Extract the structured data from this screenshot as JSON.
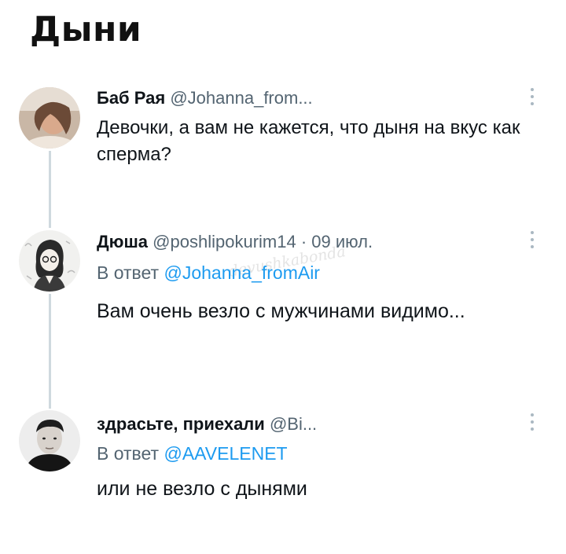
{
  "page_title": "Дыни",
  "watermark": "devushkabonda",
  "tweets": [
    {
      "author": "Баб Рая",
      "handle": "@Johanna_from...",
      "date": "",
      "reply_label": "",
      "reply_to": "",
      "text": "Девочки, а вам не кажется, что дыня на вкус как сперма?",
      "avatar_icon": "avatar-photo-woman",
      "more_icon": "more-vertical-icon"
    },
    {
      "author": "Дюша",
      "handle": "@poshlipokurim14",
      "date": "· 09 июл.",
      "reply_label": "В ответ",
      "reply_to": "@Johanna_fromAir",
      "text": "Вам очень везло с мужчинами видимо...",
      "avatar_icon": "avatar-drawing",
      "more_icon": "more-vertical-icon"
    },
    {
      "author": "здрасьте, приехали",
      "handle": "@Bi...",
      "date": "",
      "reply_label": "В ответ",
      "reply_to": "@AAVELENET",
      "text": "или не везло с дынями",
      "avatar_icon": "avatar-photo-man",
      "more_icon": "more-vertical-icon"
    }
  ],
  "colors": {
    "mention": "#1d9bf0",
    "secondary_text": "#536471",
    "thread_line": "#cfd9de"
  }
}
